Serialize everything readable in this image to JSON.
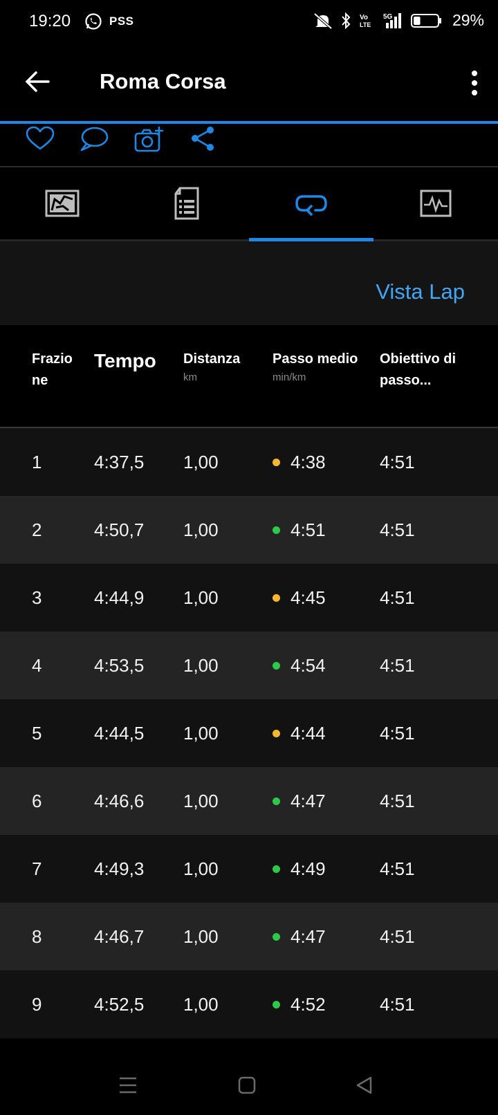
{
  "status_bar": {
    "time": "19:20",
    "carrier_label": "PSS",
    "battery_percent": "29%",
    "battery_level": 0.29
  },
  "app_bar": {
    "title": "Roma Corsa"
  },
  "view_toggle": {
    "label": "Vista Lap"
  },
  "table": {
    "headers": {
      "split": "Frazio ne",
      "time": "Tempo",
      "distance": "Distanza",
      "distance_unit": "km",
      "avg_pace": "Passo medio",
      "avg_pace_unit": "min/km",
      "target_pace": "Obiettivo di passo..."
    },
    "rows": [
      {
        "split": "1",
        "time": "4:37,5",
        "distance": "1,00",
        "pace": "4:38",
        "target": "4:51",
        "status": "fast"
      },
      {
        "split": "2",
        "time": "4:50,7",
        "distance": "1,00",
        "pace": "4:51",
        "target": "4:51",
        "status": "ok"
      },
      {
        "split": "3",
        "time": "4:44,9",
        "distance": "1,00",
        "pace": "4:45",
        "target": "4:51",
        "status": "fast"
      },
      {
        "split": "4",
        "time": "4:53,5",
        "distance": "1,00",
        "pace": "4:54",
        "target": "4:51",
        "status": "ok"
      },
      {
        "split": "5",
        "time": "4:44,5",
        "distance": "1,00",
        "pace": "4:44",
        "target": "4:51",
        "status": "fast"
      },
      {
        "split": "6",
        "time": "4:46,6",
        "distance": "1,00",
        "pace": "4:47",
        "target": "4:51",
        "status": "ok"
      },
      {
        "split": "7",
        "time": "4:49,3",
        "distance": "1,00",
        "pace": "4:49",
        "target": "4:51",
        "status": "ok"
      },
      {
        "split": "8",
        "time": "4:46,7",
        "distance": "1,00",
        "pace": "4:47",
        "target": "4:51",
        "status": "ok"
      },
      {
        "split": "9",
        "time": "4:52,5",
        "distance": "1,00",
        "pace": "4:52",
        "target": "4:51",
        "status": "ok"
      }
    ]
  },
  "colors": {
    "accent": "#1e88e5",
    "link": "#42a5f5",
    "dot_fast": "#f5b82e",
    "dot_ok": "#2ec84a"
  },
  "icons": {
    "actions": [
      "heart-icon",
      "comment-icon",
      "add-photo-icon",
      "share-icon"
    ],
    "tabs": [
      "map-tab-icon",
      "details-tab-icon",
      "laps-tab-icon",
      "charts-tab-icon"
    ],
    "nav": [
      "menu-icon",
      "home-icon",
      "back-triangle-icon"
    ]
  }
}
